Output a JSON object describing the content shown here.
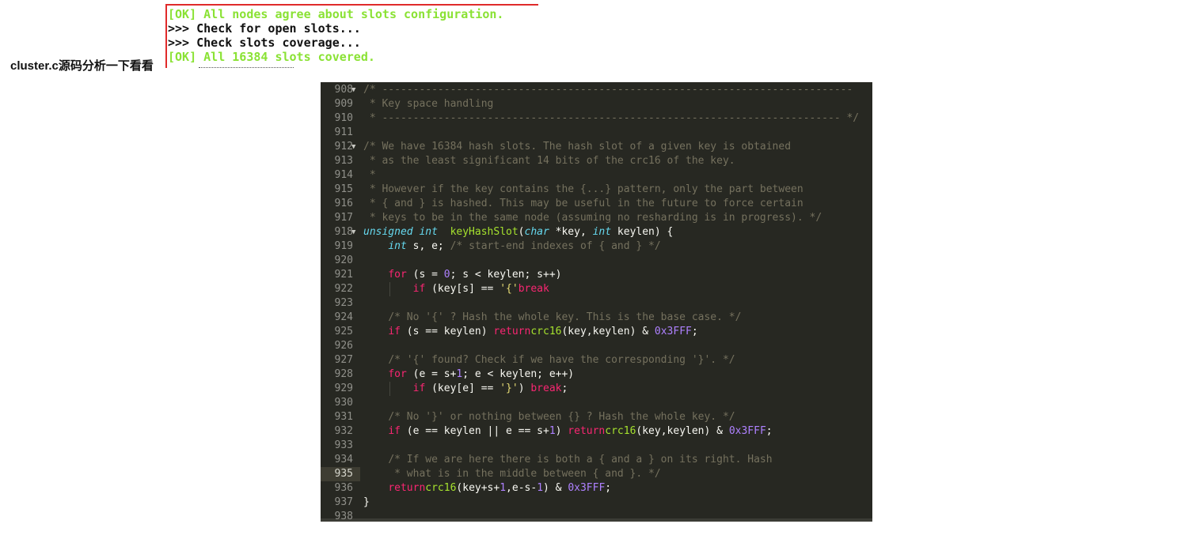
{
  "terminal": {
    "lines": [
      {
        "kind": "ok",
        "text": "[OK] All nodes agree about slots configuration."
      },
      {
        "kind": "info",
        "text": ">>> Check for open slots..."
      },
      {
        "kind": "info",
        "text": ">>> Check slots coverage..."
      },
      {
        "kind": "ok",
        "text": "[OK] All 16384 slots covered."
      }
    ]
  },
  "caption": "cluster.c源码分析一下看看",
  "editor": {
    "active_line": 935,
    "lines": [
      {
        "num": 908,
        "fold": true,
        "tokens": [
          [
            "c",
            "/* ----------------------------------------------------------------------------"
          ]
        ]
      },
      {
        "num": 909,
        "tokens": [
          [
            "c",
            " * Key space handling"
          ]
        ]
      },
      {
        "num": 910,
        "tokens": [
          [
            "c",
            " * -------------------------------------------------------------------------- */"
          ]
        ]
      },
      {
        "num": 911,
        "tokens": []
      },
      {
        "num": 912,
        "fold": true,
        "tokens": [
          [
            "c",
            "/* We have 16384 hash slots. The hash slot of a given key is obtained"
          ]
        ]
      },
      {
        "num": 913,
        "tokens": [
          [
            "c",
            " * as the least significant 14 bits of the crc16 of the key."
          ]
        ]
      },
      {
        "num": 914,
        "tokens": [
          [
            "c",
            " *"
          ]
        ]
      },
      {
        "num": 915,
        "tokens": [
          [
            "c",
            " * However if the key contains the {...} pattern, only the part between"
          ]
        ]
      },
      {
        "num": 916,
        "tokens": [
          [
            "c",
            " * { and } is hashed. This may be useful in the future to force certain"
          ]
        ]
      },
      {
        "num": 917,
        "tokens": [
          [
            "c",
            " * keys to be in the same node (assuming no resharding is in progress). */"
          ]
        ]
      },
      {
        "num": 918,
        "fold": true,
        "tokens": [
          [
            "t",
            "unsigned int"
          ],
          [
            "",
            "  "
          ],
          [
            "f",
            "keyHashSlot"
          ],
          [
            "",
            "("
          ],
          [
            "t",
            "char"
          ],
          [
            "",
            " *key, "
          ],
          [
            "t",
            "int"
          ],
          [
            "",
            " keylen) {"
          ]
        ]
      },
      {
        "num": 919,
        "tokens": [
          [
            "",
            "    "
          ],
          [
            "t",
            "int"
          ],
          [
            "",
            " s, e; "
          ],
          [
            "c",
            "/* start-end indexes of { and } */"
          ]
        ]
      },
      {
        "num": 920,
        "tokens": []
      },
      {
        "num": 921,
        "tokens": [
          [
            "",
            "    "
          ],
          [
            "k",
            "for"
          ],
          [
            "",
            " (s = "
          ],
          [
            "n",
            "0"
          ],
          [
            "",
            "; s < keylen; s++)"
          ]
        ]
      },
      {
        "num": 922,
        "tokens": [
          [
            "",
            "        "
          ],
          [
            "k",
            "if"
          ],
          [
            "",
            " (key[s] == "
          ],
          [
            "s",
            "'{'"
          ],
          [
            ") "
          ],
          [
            "k",
            "break"
          ],
          [
            ";"
          ]
        ]
      },
      {
        "num": 923,
        "tokens": []
      },
      {
        "num": 924,
        "tokens": [
          [
            "",
            "    "
          ],
          [
            "c",
            "/* No '{' ? Hash the whole key. This is the base case. */"
          ]
        ]
      },
      {
        "num": 925,
        "tokens": [
          [
            "",
            "    "
          ],
          [
            "k",
            "if"
          ],
          [
            "",
            " (s == keylen) "
          ],
          [
            "k",
            "return"
          ],
          [
            " "
          ],
          [
            "f",
            "crc16"
          ],
          [
            "",
            "(key,keylen) & "
          ],
          [
            "n",
            "0x3FFF"
          ],
          [
            "",
            ";"
          ]
        ]
      },
      {
        "num": 926,
        "tokens": []
      },
      {
        "num": 927,
        "tokens": [
          [
            "",
            "    "
          ],
          [
            "c",
            "/* '{' found? Check if we have the corresponding '}'. */"
          ]
        ]
      },
      {
        "num": 928,
        "tokens": [
          [
            "",
            "    "
          ],
          [
            "k",
            "for"
          ],
          [
            "",
            " (e = s+"
          ],
          [
            "n",
            "1"
          ],
          [
            "",
            "; e < keylen; e++)"
          ]
        ]
      },
      {
        "num": 929,
        "tokens": [
          [
            "",
            "        "
          ],
          [
            "k",
            "if"
          ],
          [
            "",
            " (key[e] == "
          ],
          [
            "s",
            "'}'"
          ],
          [
            "",
            ") "
          ],
          [
            "k",
            "break"
          ],
          [
            "",
            ";"
          ]
        ]
      },
      {
        "num": 930,
        "tokens": []
      },
      {
        "num": 931,
        "tokens": [
          [
            "",
            "    "
          ],
          [
            "c",
            "/* No '}' or nothing between {} ? Hash the whole key. */"
          ]
        ]
      },
      {
        "num": 932,
        "tokens": [
          [
            "",
            "    "
          ],
          [
            "k",
            "if"
          ],
          [
            "",
            " (e == keylen || e == s+"
          ],
          [
            "n",
            "1"
          ],
          [
            "",
            ") "
          ],
          [
            "k",
            "return"
          ],
          [
            " "
          ],
          [
            "f",
            "crc16"
          ],
          [
            "",
            "(key,keylen) & "
          ],
          [
            "n",
            "0x3FFF"
          ],
          [
            "",
            ";"
          ]
        ]
      },
      {
        "num": 933,
        "tokens": []
      },
      {
        "num": 934,
        "tokens": [
          [
            "",
            "    "
          ],
          [
            "c",
            "/* If we are here there is both a { and a } on its right. Hash"
          ]
        ]
      },
      {
        "num": 935,
        "tokens": [
          [
            "",
            "    "
          ],
          [
            "c",
            " * what is in the middle between { and }. */"
          ]
        ]
      },
      {
        "num": 936,
        "tokens": [
          [
            "",
            "    "
          ],
          [
            "k",
            "return"
          ],
          [
            " "
          ],
          [
            "f",
            "crc16"
          ],
          [
            "",
            "(key+s+"
          ],
          [
            "n",
            "1"
          ],
          [
            "",
            ",e-s-"
          ],
          [
            "n",
            "1"
          ],
          [
            "",
            ") & "
          ],
          [
            "n",
            "0x3FFF"
          ],
          [
            "",
            ";"
          ]
        ]
      },
      {
        "num": 937,
        "tokens": [
          [
            "",
            "}"
          ]
        ]
      },
      {
        "num": 938,
        "tokens": []
      }
    ]
  }
}
